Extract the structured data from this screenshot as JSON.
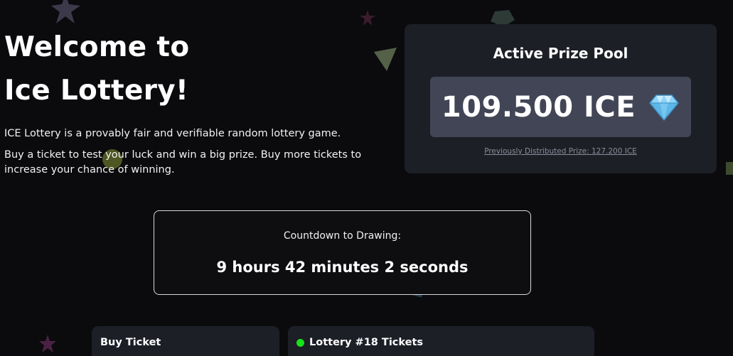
{
  "hero": {
    "title_line1": "Welcome to",
    "title_line2": "Ice Lottery!",
    "intro_1": "ICE Lottery is a provably fair and verifiable random lottery game.",
    "intro_2": "Buy a ticket to test your luck and win a big prize. Buy more tickets to increase your chance of winning."
  },
  "prize_pool": {
    "heading": "Active Prize Pool",
    "amount": "109.500 ICE",
    "icon": "gem-icon",
    "previous": "Previously Distributed Prize: 127.200 ICE"
  },
  "countdown": {
    "label": "Countdown to Drawing:",
    "value": "9 hours 42 minutes 2 seconds"
  },
  "buy_panel": {
    "title": "Buy Ticket"
  },
  "tickets_panel": {
    "title": "Lottery #18 Tickets",
    "status_color": "#17e31a"
  },
  "colors": {
    "background": "#0b0b0e",
    "card": "#1d1f27",
    "prize_box": "#414555",
    "live": "#17e31a"
  }
}
